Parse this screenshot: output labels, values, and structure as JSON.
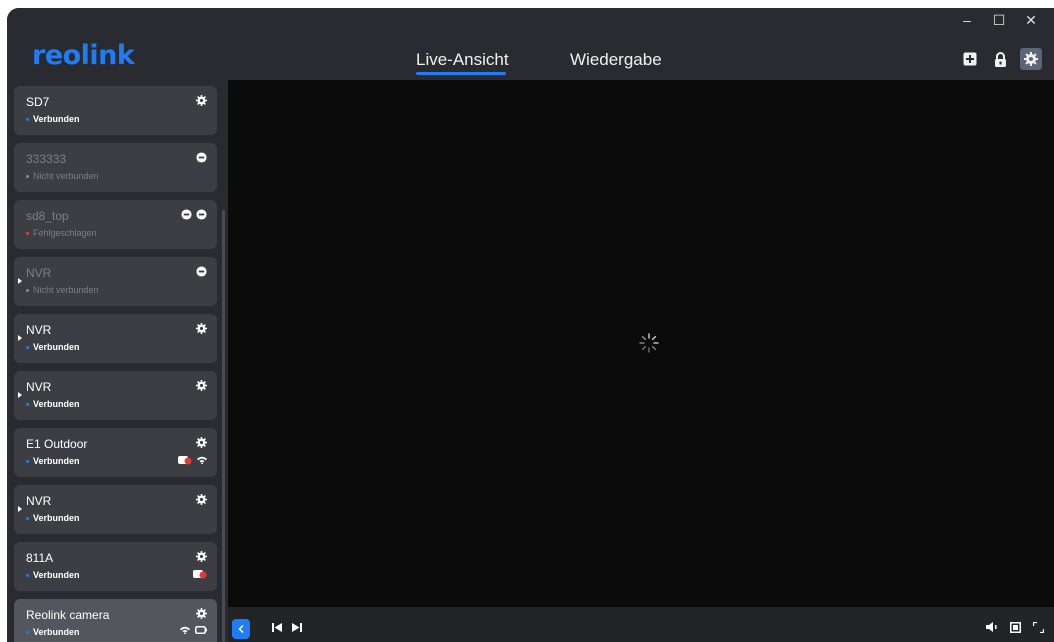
{
  "app": {
    "logo": "reolink"
  },
  "window_controls": {
    "minimize": "–",
    "maximize": "☐",
    "close": "✕"
  },
  "tabs": [
    {
      "label": "Live-Ansicht",
      "active": true
    },
    {
      "label": "Wiedergabe",
      "active": false
    }
  ],
  "top_icons": [
    "add-icon",
    "lock-icon",
    "settings-icon"
  ],
  "devices": [
    {
      "name": "SD7",
      "status": "Verbunden",
      "connected": true
    },
    {
      "name": "333333",
      "status": "Nicht verbunden",
      "connected": false
    },
    {
      "name": "sd8_top",
      "status": "Fehlgeschlagen",
      "connected": false
    },
    {
      "name": "NVR",
      "status": "Nicht verbunden",
      "connected": false
    },
    {
      "name": "NVR",
      "status": "Verbunden",
      "connected": true
    },
    {
      "name": "NVR",
      "status": "Verbunden",
      "connected": true
    },
    {
      "name": "E1 Outdoor",
      "status": "Verbunden",
      "connected": true
    },
    {
      "name": "NVR",
      "status": "Verbunden",
      "connected": true
    },
    {
      "name": "811A",
      "status": "Verbunden",
      "connected": true
    },
    {
      "name": "Reolink camera",
      "status": "Verbunden",
      "connected": true,
      "selected": true
    }
  ],
  "colors": {
    "accent": "#1f7cf5",
    "connected_dot": "#1f7cf5",
    "disconnected_dot": "#8a8c92",
    "failed_dot": "#e53935",
    "sidebar_bg": "#2a2b30",
    "card_bg": "#3d3e44",
    "video_bg": "#0b0b0b"
  }
}
